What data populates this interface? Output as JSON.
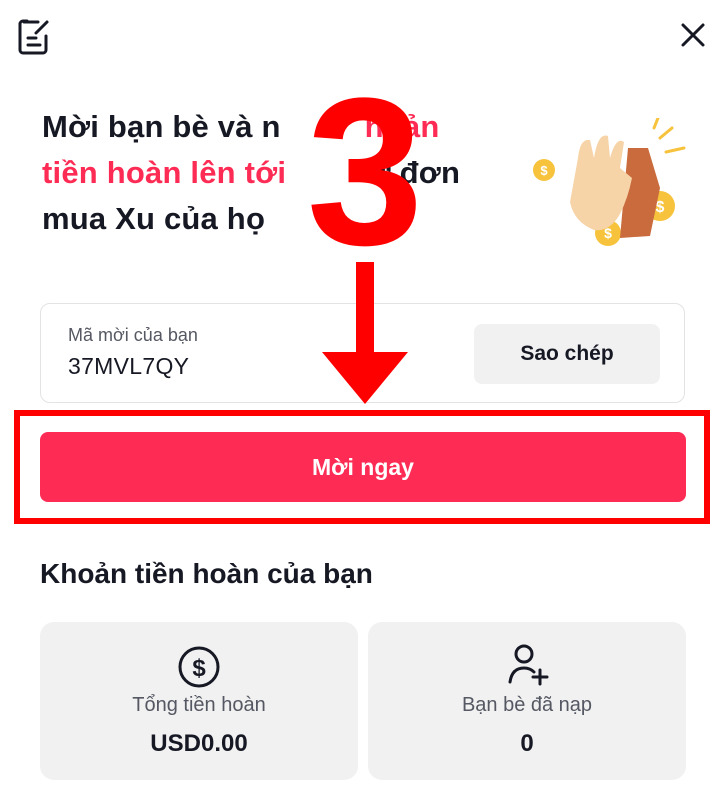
{
  "header": {
    "left_icon": "edit-note-icon",
    "close_icon": "close-icon"
  },
  "hero": {
    "headline_part1": "Mời bạn bè và n",
    "headline_part_pink_1": "hoản",
    "headline_line2_pink": "tiền hoàn lên tới",
    "headline_line2_dark": "ừ đơn",
    "headline_line3": "mua Xu của họ",
    "illustration": "high-five-coins-illustration"
  },
  "overlay": {
    "step_number": "3",
    "arrow_icon": "down-arrow-icon"
  },
  "invite_code": {
    "label": "Mã mời của bạn",
    "value": "37MVL7QY",
    "copy_label": "Sao chép"
  },
  "invite_button": {
    "label": "Mời ngay"
  },
  "rewards": {
    "title": "Khoản tiền hoàn của bạn",
    "cards": [
      {
        "icon": "dollar-circle-icon",
        "label": "Tổng tiền hoàn",
        "value": "USD0.00"
      },
      {
        "icon": "add-user-icon",
        "label": "Bạn bè đã nạp",
        "value": "0"
      }
    ]
  },
  "colors": {
    "accent": "#fe2c55",
    "annotation": "#ff0000",
    "card_bg": "#f1f1f2"
  }
}
